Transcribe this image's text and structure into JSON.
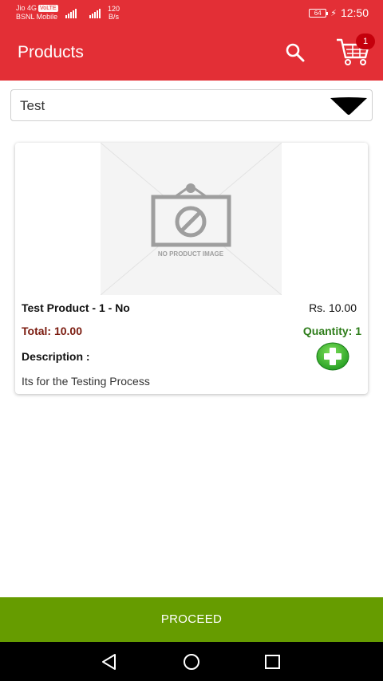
{
  "status_bar": {
    "carrier1": "Jio 4G",
    "volte": "VoLTE",
    "carrier2": "BSNL Mobile",
    "net_type": "4G",
    "speed_value": "120",
    "speed_unit": "B/s",
    "battery": "64",
    "time": "12:50"
  },
  "app_bar": {
    "title": "Products",
    "cart_count": "1",
    "icons": [
      "search-icon",
      "cart-icon"
    ]
  },
  "filter": {
    "selected": "Test"
  },
  "product": {
    "image_placeholder": "NO PRODUCT IMAGE",
    "name": "Test Product - 1 - No",
    "price": "Rs. 10.00",
    "total": "Total: 10.00",
    "quantity": "Quantity: 1",
    "description_label": "Description :",
    "description": "Its for the Testing Process"
  },
  "proceed_label": "PROCEED",
  "colors": {
    "primary": "#e32f36",
    "proceed": "#669c00",
    "quantity_green": "#2e7d1a",
    "total_brown": "#7a1a0e",
    "badge": "#c4000c"
  }
}
